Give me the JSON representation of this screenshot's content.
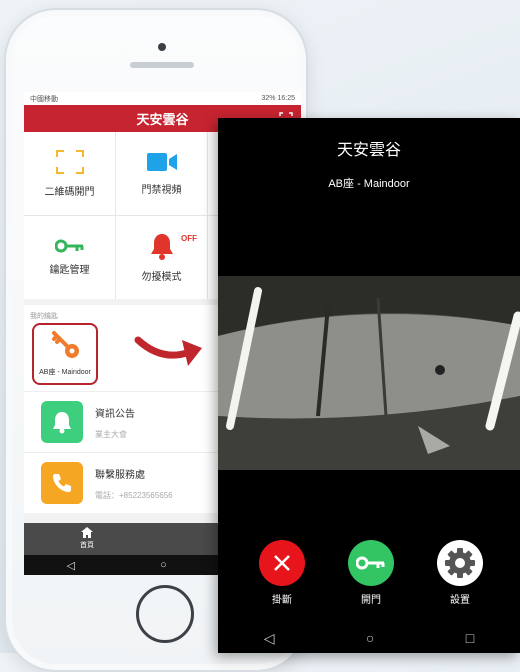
{
  "status_bar": {
    "carrier": "中國移動",
    "right": "32% 16:25"
  },
  "app": {
    "title": "天安雲谷",
    "grid": [
      {
        "label": "二維碼開門",
        "icon": "qr-scan-icon"
      },
      {
        "label": "門禁視頻",
        "icon": "video-camera-icon"
      },
      {
        "label": "鑰匙管理",
        "icon": "key-icon"
      },
      {
        "label": "勿擾模式",
        "icon": "bell-icon",
        "badge": "OFF"
      }
    ],
    "keys_section": {
      "caption": "我的鑰匙",
      "key_label": "AB座 - Maindoor"
    },
    "list": [
      {
        "title": "資訊公告",
        "subtitle": "業主大會",
        "icon": "bell-icon",
        "color": "#3ecf7e"
      },
      {
        "title": "聯繫服務處",
        "subtitle": "電話：+85223565656",
        "icon": "phone-icon",
        "color": "#f5a623"
      }
    ],
    "tabbar": {
      "home_label": "首頁"
    }
  },
  "call": {
    "title": "天安雲谷",
    "subtitle": "AB座 - Maindoor",
    "actions": [
      {
        "label": "掛斷",
        "icon": "close-icon",
        "color": "#e8141c"
      },
      {
        "label": "開門",
        "icon": "key-icon",
        "color": "#33c464"
      },
      {
        "label": "設置",
        "icon": "gear-icon",
        "color": "#ffffff"
      }
    ]
  },
  "colors": {
    "accent": "#c62430"
  }
}
